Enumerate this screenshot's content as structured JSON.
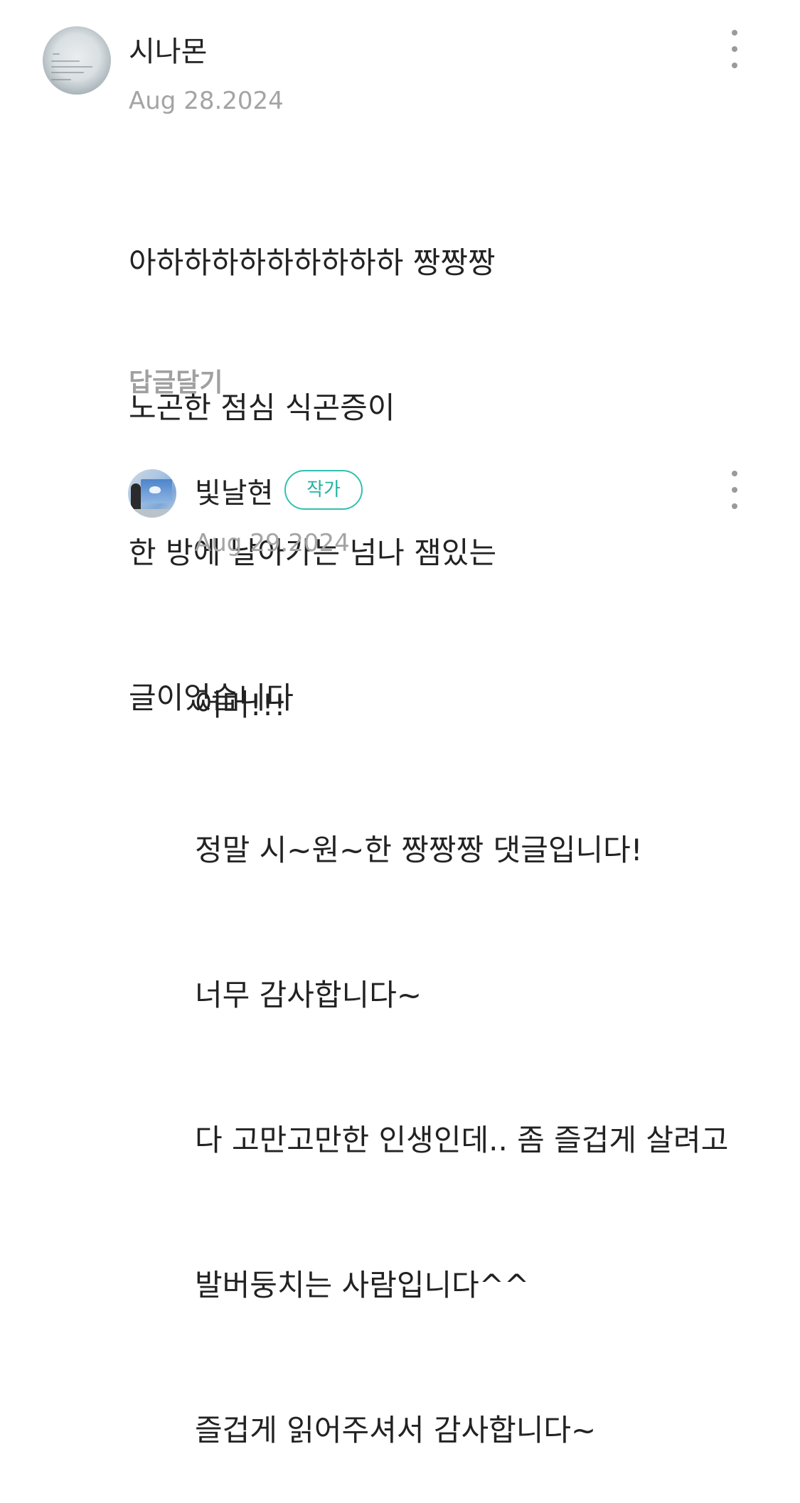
{
  "comments": [
    {
      "author": "시나몬",
      "date": "Aug 28.2024",
      "lines": [
        "아하하하하하하하하하 짱짱짱",
        "노곤한 점심 식곤증이",
        "한 방에 날아가는 넘나 잼있는",
        "글이었습니다"
      ],
      "reply_label": "답글달기",
      "avatar_icon": "profile-photo-text-image",
      "menu_icon": "more-vertical-icon"
    },
    {
      "author": "빛날현",
      "badge": "작가",
      "badge_color": "#31c0b0",
      "date": "Aug 29.2024",
      "lines": [
        "어머!!!",
        "정말 시~원~한 짱짱짱 댓글입니다!",
        "너무 감사합니다~",
        "다 고만고만한 인생인데.. 좀 즐겁게 살려고",
        "발버둥치는 사람입니다^^",
        "즐겁게 읽어주셔서 감사합니다~"
      ],
      "avatar_icon": "profile-photo-presenter-swan",
      "menu_icon": "more-vertical-icon"
    }
  ]
}
